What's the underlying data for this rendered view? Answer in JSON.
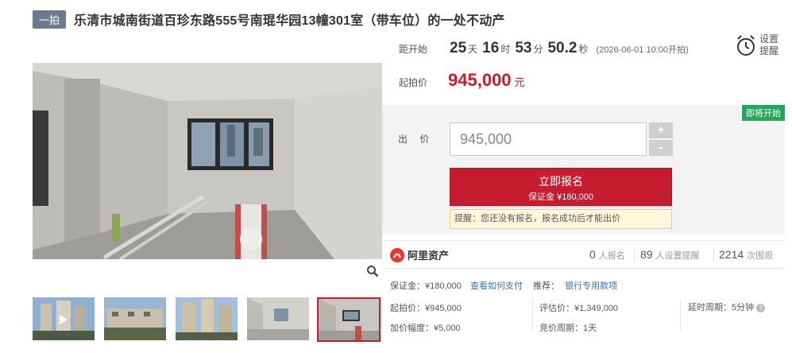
{
  "title": {
    "round_tag": "一拍",
    "text": "乐清市城南街道百珍东路555号南琨华园13幢301室（带车位）的一处不动产"
  },
  "countdown": {
    "label": "距开始",
    "days": "25",
    "days_unit": "天",
    "hours": "16",
    "hours_unit": "时",
    "minutes": "53",
    "minutes_unit": "分",
    "seconds": "50.2",
    "seconds_unit": "秒",
    "start_note": "(2026-06-01 10:00开拍)"
  },
  "reminder": {
    "line1": "设置",
    "line2": "提醒",
    "icon": "alarm-clock-icon"
  },
  "start_price": {
    "label": "起拍价",
    "value": "945,000",
    "unit": "元"
  },
  "bid": {
    "status_badge": "即将开始",
    "label": "出 价",
    "input_value": "945,000",
    "plus": "+",
    "minus": "-",
    "signup_label": "立即报名",
    "deposit_label": "保证金 ¥180,000",
    "hint": "提醒：您还没有报名，报名成功后才能出价"
  },
  "stats": {
    "brand": "阿里资产",
    "signups": "0",
    "signups_label": "人报名",
    "reminders": "89",
    "reminders_label": "人设置提醒",
    "views": "2214",
    "views_label": "次围观"
  },
  "info": {
    "deposit": "保证金：¥180,000",
    "pay_link": "查看如何支付",
    "recommend_label": "推荐：",
    "recommend_link": "银行专用款项",
    "start_price": "起拍价：¥945,000",
    "appraisal": "评估价：¥1,349,000",
    "delay": "延时周期：5分钟",
    "increment": "加价幅度：¥5,000",
    "cycle": "竞价周期：1天"
  },
  "colors": {
    "accent_red": "#c61c2f",
    "badge_green": "#26a65b",
    "link_blue": "#3b6fb6"
  }
}
